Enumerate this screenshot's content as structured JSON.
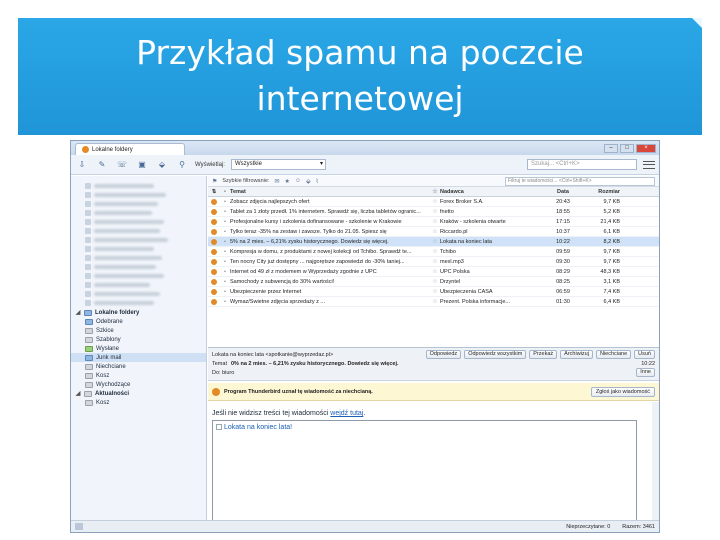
{
  "slide": {
    "title_line1": "Przykład spamu na poczcie",
    "title_line2": "internetowej"
  },
  "app": {
    "tab_title": "Lokalne foldery",
    "toolbar": {
      "view_label": "Wyświetlaj:",
      "view_value": "Wszystkie",
      "search_placeholder": "Szukaj... <Ctrl+K>"
    },
    "filterbar": {
      "filter_label": "Szybkie filtrowanie:",
      "filter_search_placeholder": "Filtruj te wiadomości... <Ctrl+Shift+K>"
    },
    "sidebar": {
      "local_folders_label": "Lokalne foldery",
      "local_folders": [
        {
          "label": "Odebrane",
          "kind": "blue"
        },
        {
          "label": "Szkice",
          "kind": "grey"
        },
        {
          "label": "Szablony",
          "kind": "grey"
        },
        {
          "label": "Wysłane",
          "kind": "green"
        },
        {
          "label": "Junk mail",
          "kind": "blue",
          "selected": true
        },
        {
          "label": "Niechciane",
          "kind": "grey"
        },
        {
          "label": "Kosz",
          "kind": "grey"
        },
        {
          "label": "Wychodzące",
          "kind": "grey"
        }
      ],
      "news_label": "Aktualności",
      "news_items": [
        {
          "label": "Kosz",
          "kind": "grey"
        }
      ]
    },
    "columns": {
      "subject": "Temat",
      "from": "Nadawca",
      "date": "Data",
      "size": "Rozmiar"
    },
    "messages": [
      {
        "subject": "Zobacz zdjęcia najlepszych ofert",
        "from": "Forex Broker S.A.",
        "date": "20:43",
        "size": "9,7 KB"
      },
      {
        "subject": "Tablet za 1 złoty przedł. 1% internetem. Sprawdź się, liczba tabletów ogranic...",
        "from": "fnetto",
        "date": "18:55",
        "size": "5,2 KB"
      },
      {
        "subject": "Profesjonalne kursy i szkolenia dofinansowane - szkolenie w Krakowie",
        "from": "Kraków - szkolenia otwarte",
        "date": "17:15",
        "size": "21,4 KB"
      },
      {
        "subject": "Tylko teraz -35% na zestaw i zawsze. Tylko do 21.05. Spiesz się",
        "from": "Riccardo.pl",
        "date": "10:37",
        "size": "6,1 KB"
      },
      {
        "subject": "5% na 2 mies. – 6,21% zysku historycznego. Dowiedz się więcej.",
        "from": "Lokata na koniec lata",
        "date": "10:22",
        "size": "8,2 KB",
        "selected": true
      },
      {
        "subject": "Kompresja w domu, z produktami z nowej kolekcji od Tchibo. Sprawdź te...",
        "from": "Tchibo",
        "date": "09:59",
        "size": "9,7 KB"
      },
      {
        "subject": "Ten nocny City już dostępny ... najgorętsze zapowiedzi do -30% taniej...",
        "from": "mexl.mp3",
        "date": "09:30",
        "size": "9,7 KB"
      },
      {
        "subject": "Internet od 49 zł z modemem w Wyprzedaży zgodnie z UPC",
        "from": "UPC Polska",
        "date": "08:29",
        "size": "48,3 KB"
      },
      {
        "subject": "Samochody z subwencją do 30% wartości!",
        "from": "Drzyntel",
        "date": "08:25",
        "size": "3,1 KB"
      },
      {
        "subject": "Ubezpieczenie przez Internet",
        "from": "Ubezpieczenia CASA",
        "date": "06:59",
        "size": "7,4 KB"
      },
      {
        "subject": "Wymaz/Świetne zdjęcia sprzedaży z ...",
        "from": "Prezent. Polska informacje...",
        "date": "01:30",
        "size": "6,4 KB"
      }
    ],
    "preview": {
      "subject_label": "Temat",
      "from_line": "Lokata na koniec lata <spotkanie@wyprzedaz.pl>",
      "subject_value": "0% na 2 mies. – 6,21% zysku historycznego. Dowiedz się więcej.",
      "to_line": "Do: biuro",
      "time": "10:22",
      "buttons": {
        "reply": "Odpowiedz",
        "reply_all": "Odpowiedz wszystkim",
        "forward": "Przekaż",
        "archive": "Archiwizuj",
        "junk": "Niechciane",
        "other": "Inne",
        "delete": "Usuń"
      }
    },
    "notification": {
      "text": "Program Thunderbird uznał tę wiadomość za niechcianą.",
      "button": "Zgłoś jako wiadomość"
    },
    "body": {
      "not_visible": "Jeśli nie widzisz treści tej wiadomości",
      "see_here": "wejdź tutaj",
      "image_alt": "Lokata na koniec lata!"
    },
    "status": {
      "unread": "Nieprzeczytane: 0",
      "total": "Razem: 3461"
    }
  }
}
